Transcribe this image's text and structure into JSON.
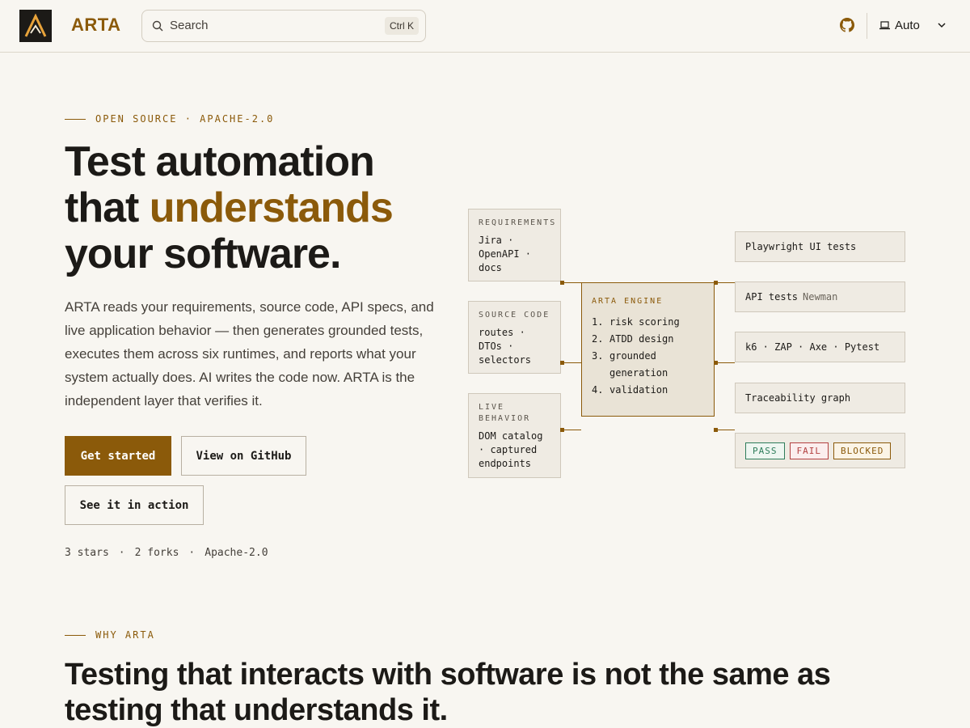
{
  "header": {
    "brand": "ARTA",
    "search": {
      "placeholder": "Search",
      "shortcut": "Ctrl K"
    },
    "theme_label": "Auto"
  },
  "hero": {
    "eyebrow": "OPEN SOURCE · APACHE-2.0",
    "title_line1": "Test automation",
    "title_line2_pre": "that ",
    "title_line2_accent": "understands",
    "title_line3": "your software.",
    "lede": "ARTA reads your requirements, source code, API specs, and live application behavior — then generates grounded tests, executes them across six runtimes, and reports what your system actually does. AI writes the code now. ARTA is the independent layer that verifies it.",
    "buttons": {
      "get_started": "Get started",
      "github": "View on GitHub",
      "action": "See it in action"
    },
    "meta": {
      "stars": "3 stars",
      "forks": "2 forks",
      "license": "Apache-2.0",
      "sep": "·"
    }
  },
  "diagram": {
    "inputs": [
      {
        "label": "REQUIREMENTS",
        "text": "Jira · OpenAPI · docs"
      },
      {
        "label": "SOURCE CODE",
        "text": "routes · DTOs · selectors"
      },
      {
        "label": "LIVE BEHAVIOR",
        "text": "DOM catalog · captured endpoints"
      }
    ],
    "engine": {
      "label": "ARTA ENGINE",
      "steps": [
        "risk scoring",
        "ATDD design",
        "grounded generation",
        "validation"
      ]
    },
    "outputs": {
      "playwright": "Playwright UI tests",
      "api": "API tests",
      "api_dim": "Newman",
      "tools": "k6 · ZAP · Axe · Pytest",
      "graph": "Traceability graph",
      "pass": "PASS",
      "fail": "FAIL",
      "blocked": "BLOCKED"
    }
  },
  "why": {
    "eyebrow": "WHY ARTA",
    "title": "Testing that interacts with software is not the same as testing that understands it."
  },
  "colors": {
    "accent": "#8b5a0a",
    "background": "#f8f6f1",
    "text": "#1c1a17"
  }
}
